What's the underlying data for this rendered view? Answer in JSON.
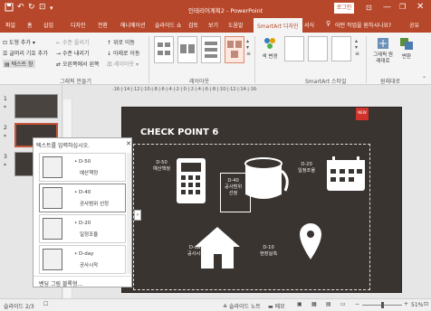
{
  "title_bar": {
    "document_title": "인테리어계획2 - PowerPoint",
    "login_button": "로그인",
    "qat_autosave": "저장"
  },
  "tabs": {
    "items": [
      "파일",
      "홈",
      "삽입",
      "디자인",
      "전환",
      "애니메이션",
      "슬라이드 쇼",
      "검토",
      "보기",
      "도움말",
      "SmartArt 디자인",
      "서식"
    ],
    "selected": "SmartArt 디자인",
    "tell_me": "어떤 작업을 원하시나요?",
    "share": "공유"
  },
  "ribbon": {
    "add_shape": "도형 추가",
    "add_bullet": "글머리 기호 추가",
    "text_pane": "텍스트 창",
    "promote": "수준 올리기",
    "demote": "수준 내리기",
    "right_to_left": "오른쪽에서 왼쪽",
    "move_up": "위로 이동",
    "move_down": "아래로 이동",
    "layout_btn": "레이아웃",
    "create_graphic_label": "그래픽 만들기",
    "layouts_label": "레이아웃",
    "change_colors": "색 변경",
    "smartart_styles_label": "SmartArt 스타일",
    "reset_graphic": "그래픽 원래대로",
    "convert": "변환",
    "reset_label": "원래대로"
  },
  "thumbnails": [
    {
      "num": "1",
      "star": "*"
    },
    {
      "num": "2",
      "star": "*"
    },
    {
      "num": "3",
      "star": "*"
    }
  ],
  "ruler_text": "·16·|·14·|·12·|·10·|·8·|·6·|·4·|·2·|·0·|·2·|·4·|·6·|·8·|·10·|·12·|·14·|·16·",
  "slide": {
    "title": "CHECK POINT 6",
    "badge": "NEW",
    "nodes": [
      {
        "l1": "D-50",
        "l2": "예산책정"
      },
      {
        "l1": "D-40",
        "l2": "공사범위",
        "l3": "선정"
      },
      {
        "l1": "D-20",
        "l2": "일정조율"
      },
      {
        "l1": "D-day",
        "l2": "공사시작"
      },
      {
        "l1": "D-10",
        "l2": "현장실측"
      }
    ]
  },
  "text_pane": {
    "title": "텍스트를 입력하십시오.",
    "items": [
      {
        "l1": "• D-50",
        "l2": "예산책정"
      },
      {
        "l1": "• D-40",
        "l2": "공사범위 선정"
      },
      {
        "l1": "• D-20",
        "l2": "일정조율"
      },
      {
        "l1": "• D-day",
        "l2": "공사시작"
      }
    ],
    "footer": "벤딩 그림 블록형..."
  },
  "status_bar": {
    "slide_info": "슬라이드 2/3",
    "notes": "슬라이드 노트",
    "comments": "메모",
    "zoom": "51%"
  }
}
